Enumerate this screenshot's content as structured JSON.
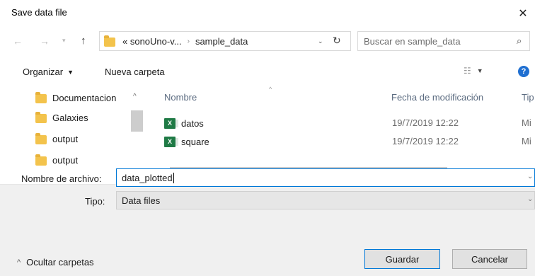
{
  "dialog": {
    "title": "Save data file"
  },
  "nav": {
    "address_segments": [
      "« sonoUno-v...",
      "sample_data"
    ],
    "search_placeholder": "Buscar en sample_data"
  },
  "toolbar": {
    "organize": "Organizar",
    "new_folder": "Nueva carpeta"
  },
  "sidebar": {
    "items": [
      {
        "label": "Documentacion"
      },
      {
        "label": "Galaxies"
      },
      {
        "label": "output"
      },
      {
        "label": "output"
      }
    ]
  },
  "file_list": {
    "columns": {
      "name": "Nombre",
      "modified": "Fecha de modificación",
      "type": "Tip"
    },
    "rows": [
      {
        "name": "datos",
        "modified": "19/7/2019 12:22",
        "type": "Mi"
      },
      {
        "name": "square",
        "modified": "19/7/2019 12:22",
        "type": "Mi"
      }
    ]
  },
  "form": {
    "filename_label": "Nombre de archivo:",
    "filename_value": "data_plotted",
    "type_label": "Tipo:",
    "type_value": "Data files"
  },
  "footer": {
    "hide_folders": "Ocultar carpetas",
    "save": "Guardar",
    "cancel": "Cancelar"
  },
  "colors": {
    "accent": "#0078d7",
    "help": "#1f6fd1",
    "folder": "#f3c34c",
    "excel": "#1f7a45"
  }
}
